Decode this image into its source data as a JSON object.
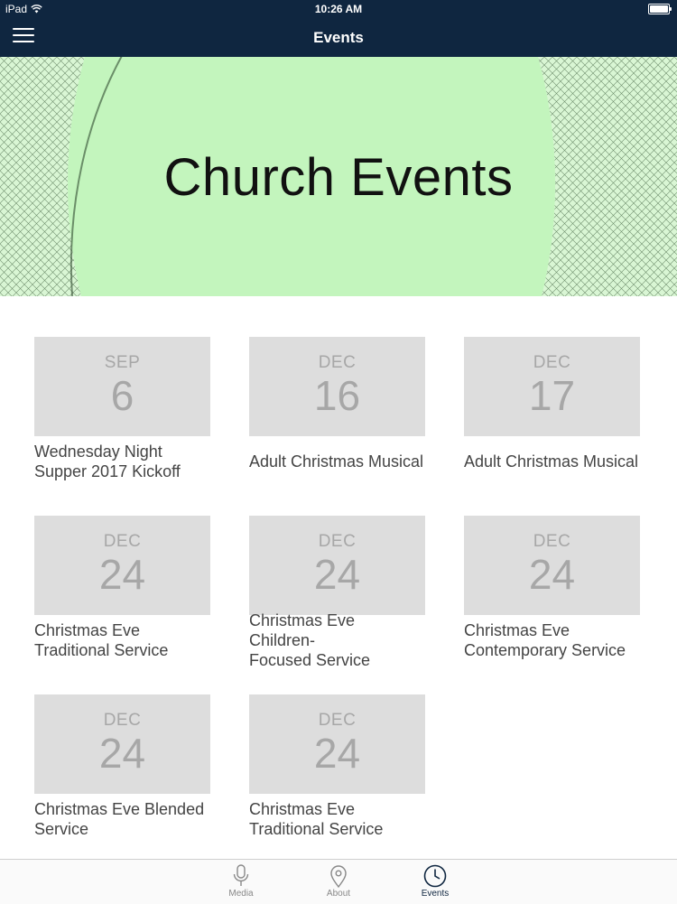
{
  "status": {
    "carrier": "iPad",
    "time": "10:26 AM"
  },
  "nav": {
    "title": "Events"
  },
  "hero": {
    "title": "Church Events"
  },
  "events": [
    {
      "month": "SEP",
      "day": "6",
      "title_line1": "Wednesday Night",
      "title_line2": "Supper 2017 Kickoff"
    },
    {
      "month": "DEC",
      "day": "16",
      "title_line1": "Adult Christmas Musical",
      "title_line2": ""
    },
    {
      "month": "DEC",
      "day": "17",
      "title_line1": "Adult Christmas Musical",
      "title_line2": ""
    },
    {
      "month": "DEC",
      "day": "24",
      "title_line1": "Christmas Eve",
      "title_line2": "Traditional Service"
    },
    {
      "month": "DEC",
      "day": "24",
      "title_line1": "Christmas Eve Children-",
      "title_line2": "Focused Service"
    },
    {
      "month": "DEC",
      "day": "24",
      "title_line1": "Christmas Eve",
      "title_line2": "Contemporary Service"
    },
    {
      "month": "DEC",
      "day": "24",
      "title_line1": "Christmas Eve Blended",
      "title_line2": "Service"
    },
    {
      "month": "DEC",
      "day": "24",
      "title_line1": "Christmas Eve",
      "title_line2": "Traditional Service"
    }
  ],
  "tabs": [
    {
      "label": "Media",
      "icon": "microphone-icon",
      "active": false
    },
    {
      "label": "About",
      "icon": "location-pin-icon",
      "active": false
    },
    {
      "label": "Events",
      "icon": "clock-icon",
      "active": true
    }
  ],
  "colors": {
    "nav_bg": "#0f2640",
    "hero_bg": "#c3f2bd",
    "tile_bg": "#dddddd"
  }
}
